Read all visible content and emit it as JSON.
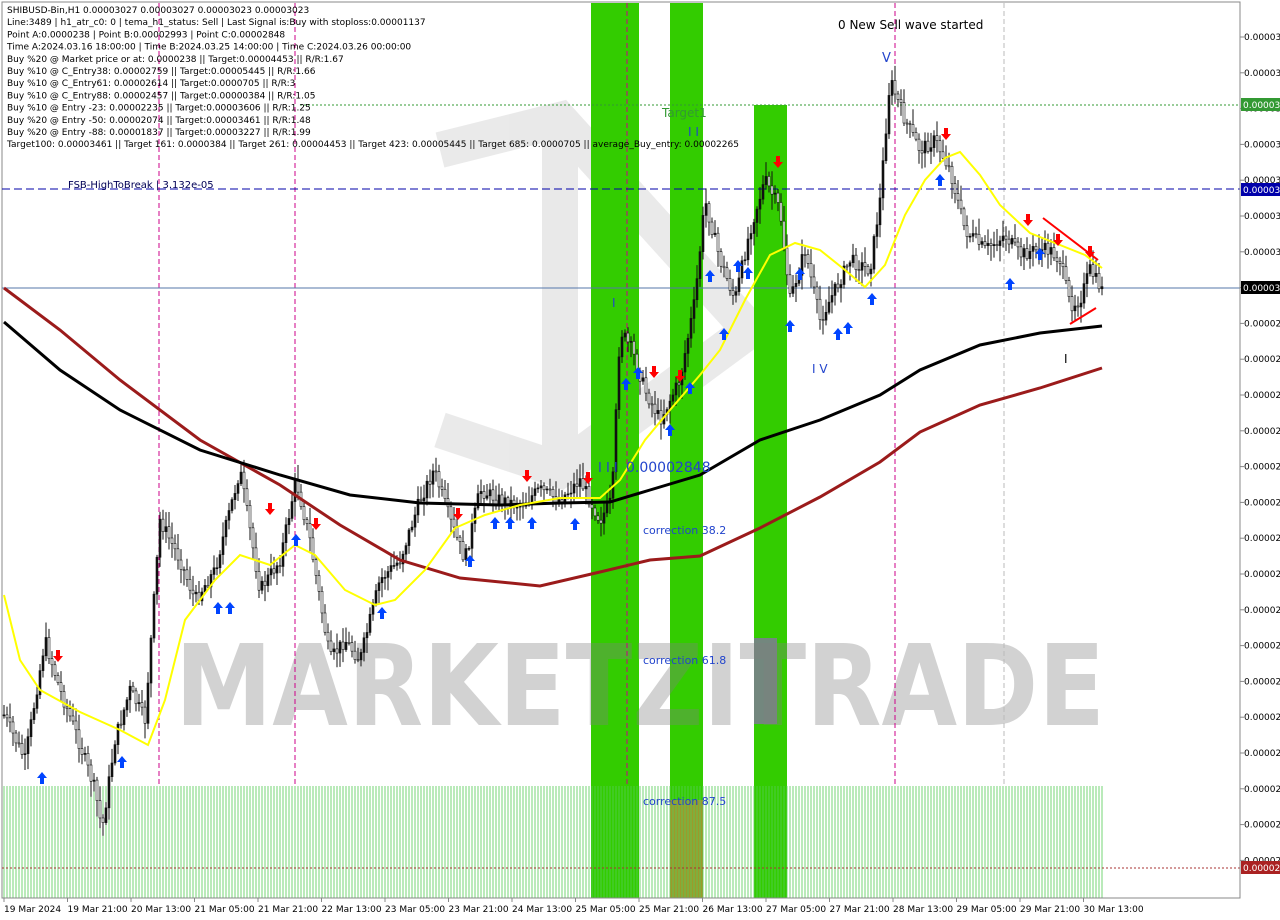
{
  "info_lines": [
    "SHIBUSD-Bin,H1  0.00003027 0.00003027 0.00003023 0.00003023",
    "Line:3489 | h1_atr_c0: 0 | tema_h1_status: Sell | Last Signal is:Buy with stoploss:0.00001137",
    "Point A:0.0000238 | Point B:0.00002993 | Point C:0.00002848",
    "Time A:2024.03.16 18:00:00 | Time B:2024.03.25 14:00:00 | Time C:2024.03.26 00:00:00",
    "Buy %20 @ Market price or at: 0.0000238 || Target:0.00004453 || R/R:1.67",
    "Buy %10 @ C_Entry38: 0.00002759 || Target:0.00005445 || R/R:1.66",
    "Buy %10 @ C_Entry61: 0.00002614 || Target:0.0000705 || R/R:3",
    "Buy %10 @ C_Entry88: 0.00002457 || Target:0.00000384 || R/R:1.05",
    "Buy %10 @ Entry -23: 0.00002235 || Target:0.00003606 || R/R:1.25",
    "Buy %20 @ Entry -50: 0.00002074 || Target:0.00003461 || R/R:1.48",
    "Buy %20 @ Entry -88: 0.00001837 || Target:0.00003227 || R/R:1.99",
    "Target100: 0.00003461 || Target 161: 0.0000384 || Target 261: 0.00004453 || Target 423: 0.00005445 || Target 685: 0.0000705 || average_Buy_entry: 0.00002265"
  ],
  "annotations": {
    "new_sell_wave": "0 New Sell wave started",
    "target1": "Target1",
    "fsb_high_to_break": "FSB-HighToBreak | 3.132e-05",
    "point_c_label": "0.00002848",
    "correction_38": "correction 38.2",
    "correction_61": "correction 61.8",
    "correction_87": "correction 87.5",
    "wave_ii": "I I",
    "wave_iii": "I I I",
    "wave_iv": "I V",
    "wave_v": "V",
    "wave_i": "I",
    "watermark": "MARKETZITRADE"
  },
  "price_axis": {
    "labels": [
      "0.00003",
      "0.00003",
      "0.00003",
      "0.00003",
      "0.00003",
      "0.00003",
      "0.00003",
      "0.00003",
      "0.00002",
      "0.00002",
      "0.00002",
      "0.00002",
      "0.00002",
      "0.00002",
      "0.00002",
      "0.00002",
      "0.00002",
      "0.00002",
      "0.00002",
      "0.00002",
      "0.00002",
      "0.00002",
      "0.00002",
      "0.00002"
    ],
    "current_price_label": "0.00003",
    "target_label": "0.00003",
    "fsb_label": "0.00003",
    "stop_label": "0.00002"
  },
  "time_axis": {
    "labels": [
      "19 Mar 2024",
      "19 Mar 21:00",
      "20 Mar 13:00",
      "21 Mar 05:00",
      "21 Mar 21:00",
      "22 Mar 13:00",
      "23 Mar 05:00",
      "23 Mar 21:00",
      "24 Mar 13:00",
      "25 Mar 05:00",
      "25 Mar 21:00",
      "26 Mar 13:00",
      "27 Mar 05:00",
      "27 Mar 21:00",
      "28 Mar 13:00",
      "29 Mar 05:00",
      "29 Mar 21:00",
      "30 Mar 13:00"
    ]
  },
  "colors": {
    "green_band": "#33cc00",
    "yellow_line": "#ffff00",
    "black_ma": "#000000",
    "red_ma": "#9b1b1b",
    "buy_arrow": "#0044ff",
    "sell_arrow": "#ff0000",
    "level_blue": "#0000aa",
    "level_green": "#339933"
  },
  "chart_data": {
    "type": "line",
    "title": "SHIBUSD-Bin,H1",
    "x": [
      "19 Mar 2024",
      "19 Mar 21:00",
      "20 Mar 13:00",
      "21 Mar 05:00",
      "21 Mar 21:00",
      "22 Mar 13:00",
      "23 Mar 05:00",
      "23 Mar 21:00",
      "24 Mar 13:00",
      "25 Mar 05:00",
      "25 Mar 21:00",
      "26 Mar 13:00",
      "27 Mar 05:00",
      "27 Mar 21:00",
      "28 Mar 13:00",
      "29 Mar 05:00",
      "29 Mar 21:00",
      "30 Mar 13:00"
    ],
    "series": [
      {
        "values": [
          2.36e-05,
          2.28e-05,
          2.47e-05,
          2.5e-05,
          2.53e-05,
          2.43e-05,
          2.64e-05,
          2.69e-05,
          2.7e-05,
          2.7e-05,
          2.86e-05,
          2.99e-05,
          2.93e-05,
          3.02e-05,
          3.26e-05,
          3.13e-05,
          3.01e-05,
          2.96e-05
        ]
      }
    ],
    "ylim": [
      2.13e-05,
      3.46e-05
    ],
    "levels": {
      "point_a": 2.38e-05,
      "point_b": 2.993e-05,
      "point_c": 2.848e-05,
      "fsb_high_to_break": 3.132e-05
    }
  }
}
